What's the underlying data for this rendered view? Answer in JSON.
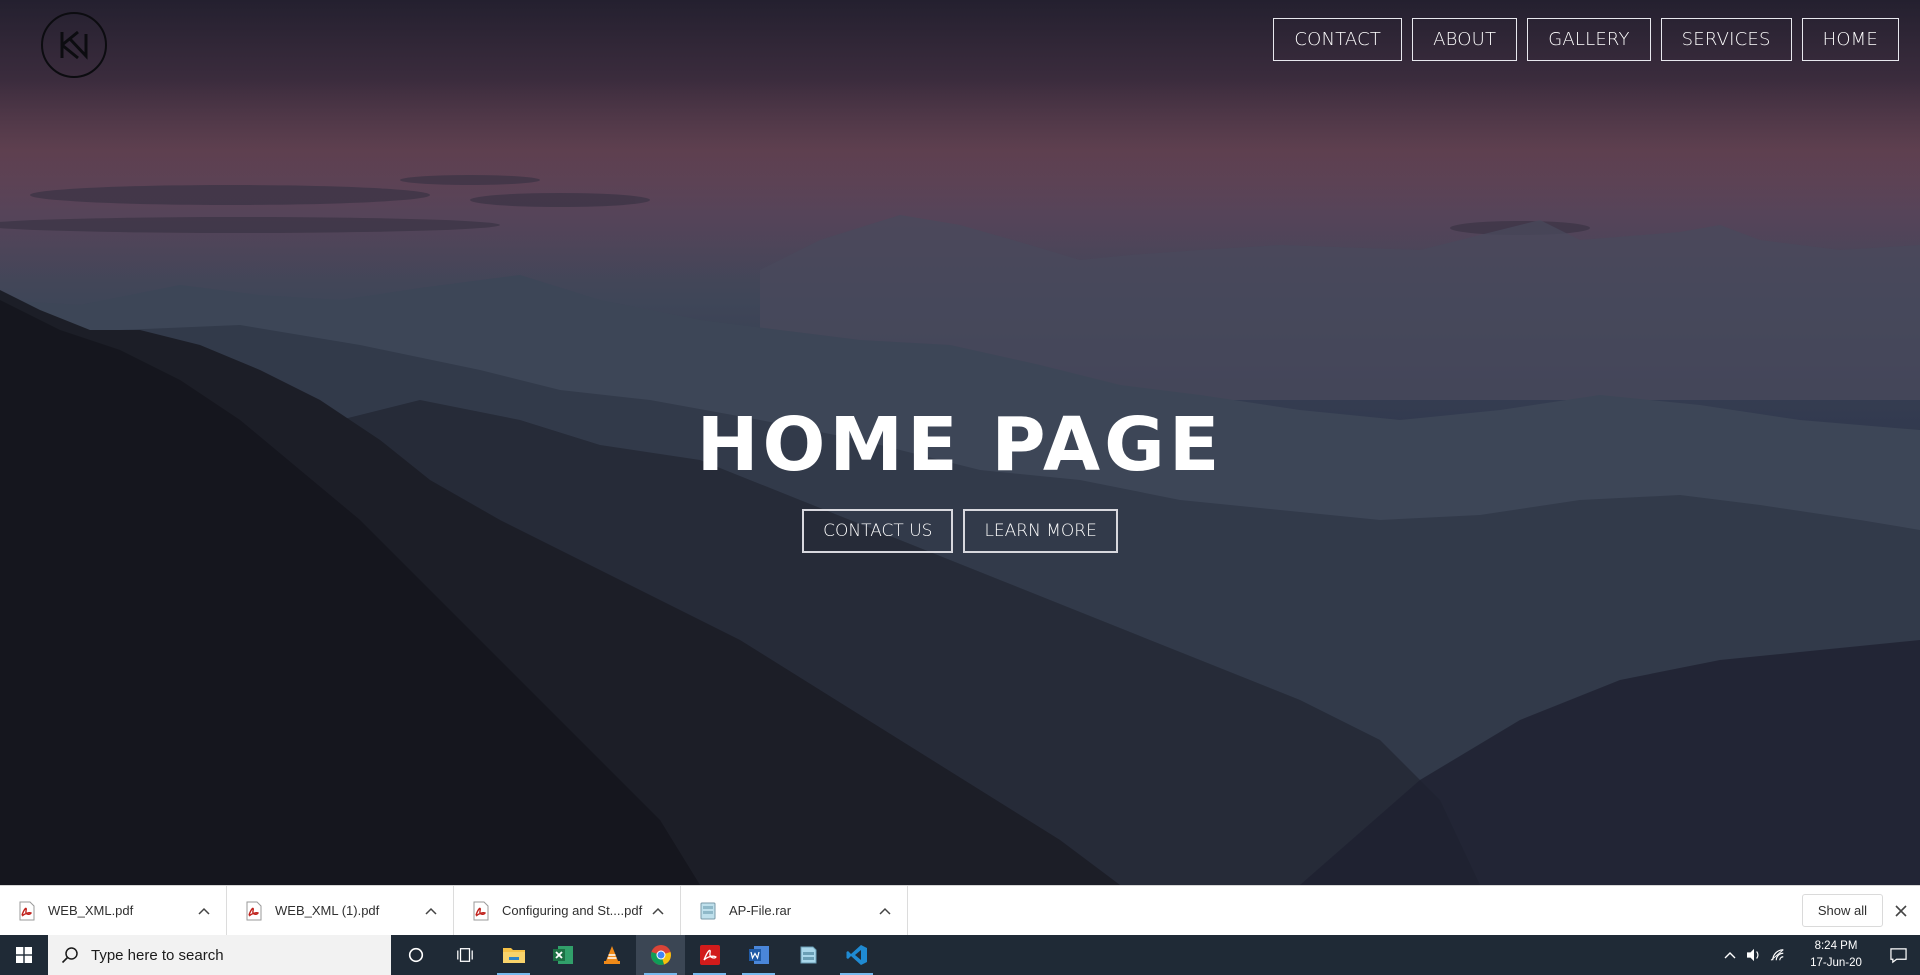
{
  "hero": {
    "title": "HOME PAGE",
    "nav": [
      "CONTACT",
      "ABOUT",
      "GALLERY",
      "SERVICES",
      "HOME"
    ],
    "buttons": [
      "CONTACT US",
      "LEARN MORE"
    ]
  },
  "downloads": {
    "items": [
      {
        "name": "WEB_XML.pdf",
        "icon": "pdf-file-icon"
      },
      {
        "name": "WEB_XML (1).pdf",
        "icon": "pdf-file-icon"
      },
      {
        "name": "Configuring and St....pdf",
        "icon": "pdf-file-icon"
      },
      {
        "name": "AP-File.rar",
        "icon": "archive-file-icon"
      }
    ],
    "show_all": "Show all"
  },
  "taskbar": {
    "search_placeholder": "Type here to search",
    "apps": [
      "cortana-icon",
      "task-view-icon",
      "file-explorer-icon",
      "excel-icon",
      "vlc-icon",
      "chrome-icon",
      "acrobat-icon",
      "word-icon",
      "archive-app-icon",
      "vscode-icon"
    ],
    "time": "8:24 PM",
    "date": "17-Jun-20"
  },
  "colors": {
    "taskbar": "#1f2a36",
    "download_bar": "#ffffff",
    "accent_underline": "#76b9ed"
  }
}
